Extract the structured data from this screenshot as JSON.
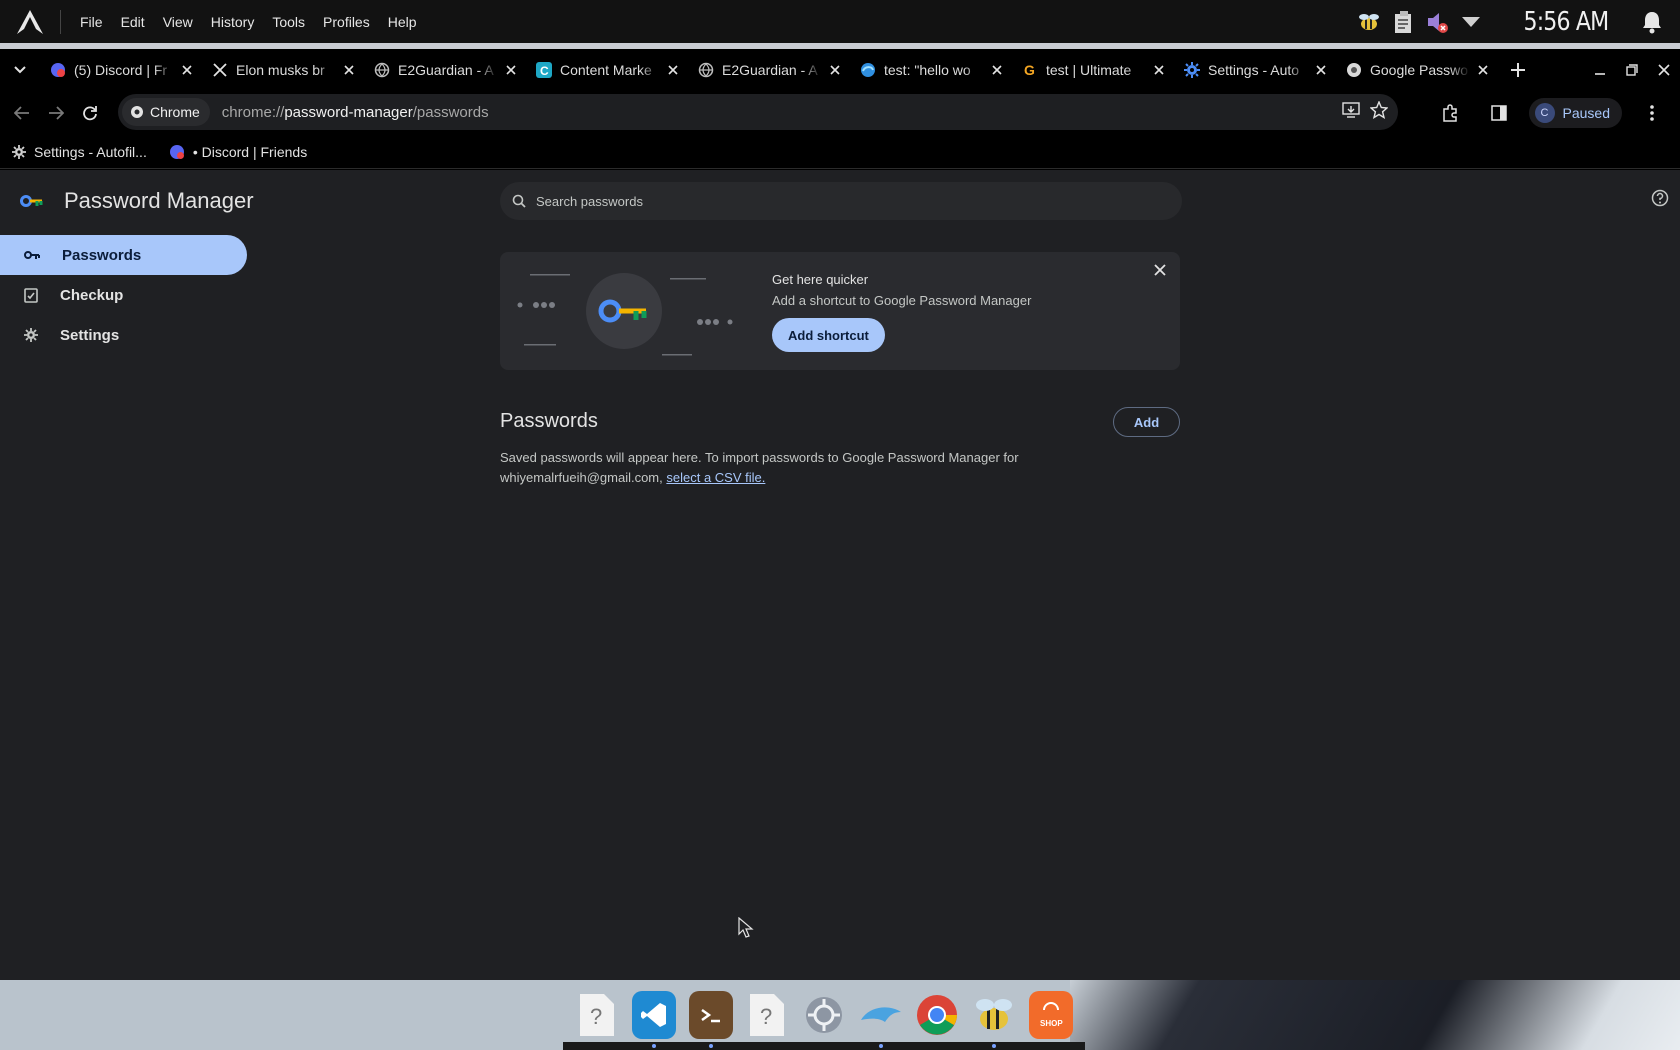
{
  "system": {
    "menu": [
      "File",
      "Edit",
      "View",
      "History",
      "Tools",
      "Profiles",
      "Help"
    ],
    "clock": "5:56 AM"
  },
  "tabs": [
    {
      "title": "(5) Discord | Fr",
      "icon": "discord-icon"
    },
    {
      "title": "Elon musks br",
      "icon": "x-icon"
    },
    {
      "title": "E2Guardian - A",
      "icon": "globe-icon"
    },
    {
      "title": "Content Marke",
      "icon": "c-app-icon"
    },
    {
      "title": "E2Guardian - A",
      "icon": "globe-icon"
    },
    {
      "title": "test: \"hello wo",
      "icon": "edge-icon"
    },
    {
      "title": "test | Ultimate",
      "icon": "g-icon"
    },
    {
      "title": "Settings - Auto",
      "icon": "gear-icon"
    },
    {
      "title": "Google Passwo",
      "icon": "chrome-icon"
    }
  ],
  "omnibox": {
    "chip": "Chrome",
    "scheme": "chrome://",
    "host": "password-manager",
    "path": "/passwords"
  },
  "profile": {
    "initial": "C",
    "label": "Paused"
  },
  "bookmarks": [
    {
      "label": "Settings - Autofil...",
      "icon": "gear-icon"
    },
    {
      "label": "• Discord | Friends",
      "icon": "discord-icon"
    }
  ],
  "app": {
    "title": "Password Manager",
    "nav": [
      {
        "label": "Passwords",
        "icon": "key-icon"
      },
      {
        "label": "Checkup",
        "icon": "checkup-icon"
      },
      {
        "label": "Settings",
        "icon": "gear-icon"
      }
    ],
    "search_placeholder": "Search passwords"
  },
  "promo": {
    "heading": "Get here quicker",
    "subtext": "Add a shortcut to Google Password Manager",
    "button": "Add shortcut"
  },
  "passwords": {
    "title": "Passwords",
    "add_button": "Add",
    "desc_prefix": "Saved passwords will appear here. To import passwords to Google Password Manager for whiyemalrfueih@gmail.com,",
    "desc_link": "select a CSV file."
  },
  "dock": [
    "unknown-file-icon",
    "vscode-icon",
    "terminal-icon",
    "unknown-file-icon",
    "settings-icon",
    "dolphin-icon",
    "chrome-icon",
    "bee-icon",
    "shop-icon"
  ],
  "dock_shop_label": "SHOP",
  "colors": {
    "accent": "#a8c7fa",
    "page_bg": "#1f2023",
    "surface": "#2a2b2f"
  }
}
